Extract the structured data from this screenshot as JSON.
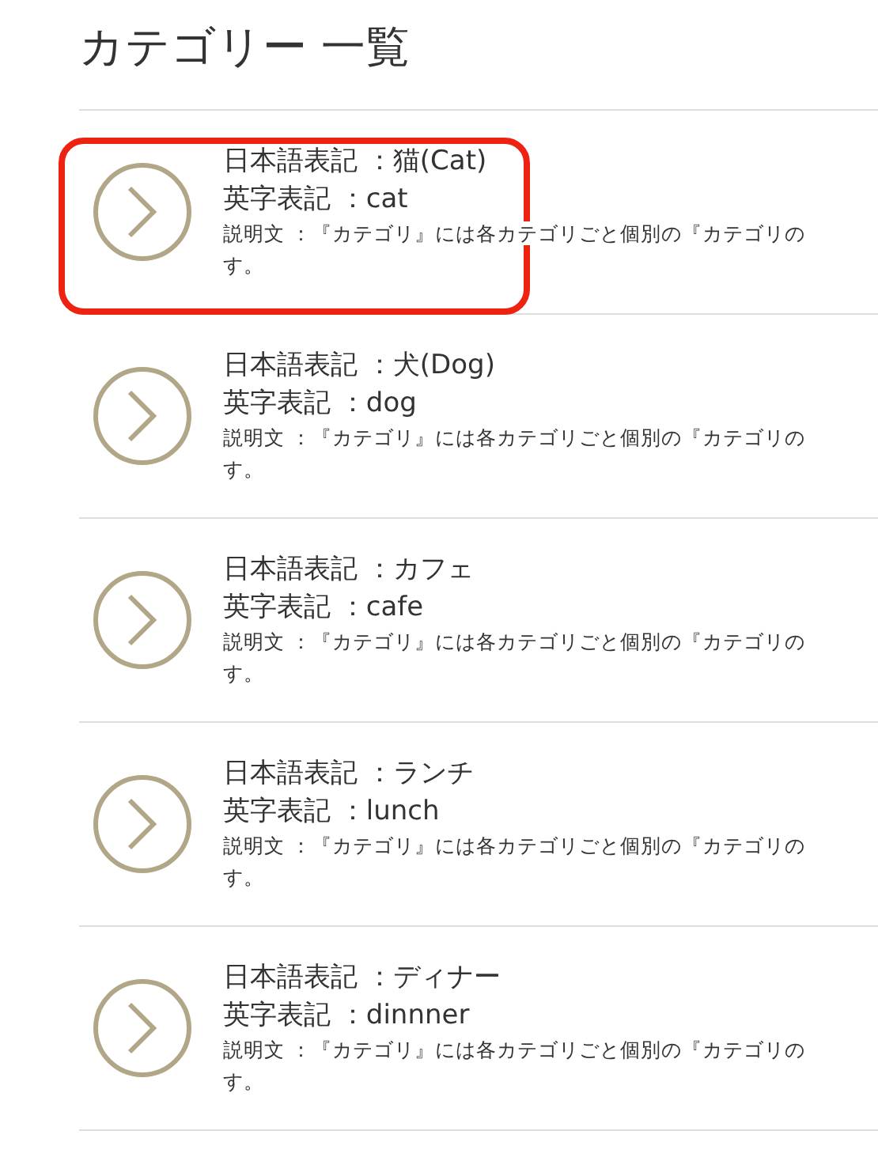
{
  "page_title": "カテゴリー 一覧",
  "categories": [
    {
      "japanese": "日本語表記 ：猫(Cat)",
      "english": "英字表記 ：cat",
      "description": "説明文 ：『カテゴリ』には各カテゴリごと個別の『カテゴリの",
      "description_end": "す。",
      "highlighted": true
    },
    {
      "japanese": "日本語表記 ：犬(Dog)",
      "english": "英字表記 ：dog",
      "description": "説明文 ：『カテゴリ』には各カテゴリごと個別の『カテゴリの",
      "description_end": "す。",
      "highlighted": false
    },
    {
      "japanese": "日本語表記 ：カフェ",
      "english": "英字表記 ：cafe",
      "description": "説明文 ：『カテゴリ』には各カテゴリごと個別の『カテゴリの",
      "description_end": "す。",
      "highlighted": false
    },
    {
      "japanese": "日本語表記 ：ランチ",
      "english": "英字表記 ：lunch",
      "description": "説明文 ：『カテゴリ』には各カテゴリごと個別の『カテゴリの",
      "description_end": "す。",
      "highlighted": false
    },
    {
      "japanese": "日本語表記 ：ディナー",
      "english": "英字表記 ：dinnner",
      "description": "説明文 ：『カテゴリ』には各カテゴリごと個別の『カテゴリの",
      "description_end": "す。",
      "highlighted": false
    }
  ]
}
